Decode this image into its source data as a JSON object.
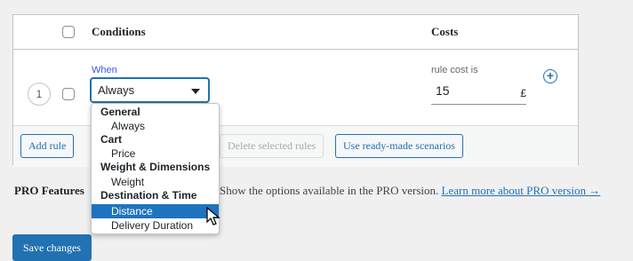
{
  "table": {
    "headers": {
      "conditions": "Conditions",
      "costs": "Costs"
    },
    "row": {
      "index": "1",
      "when_label": "When",
      "condition_value": "Always",
      "cost_label": "rule cost is",
      "cost_value": "15",
      "currency": "£"
    },
    "footer_buttons": {
      "add_rule": "Add rule",
      "delete_selected": "Delete selected rules",
      "scenarios": "Use ready-made scenarios"
    }
  },
  "dropdown": {
    "groups": [
      {
        "label": "General",
        "options": [
          "Always"
        ]
      },
      {
        "label": "Cart",
        "options": [
          "Price"
        ]
      },
      {
        "label": "Weight & Dimensions",
        "options": [
          "Weight"
        ]
      },
      {
        "label": "Destination & Time",
        "options": [
          "Distance",
          "Delivery Duration"
        ]
      }
    ],
    "highlighted": "Distance"
  },
  "pro": {
    "label": "PRO Features",
    "text": "Show the options available in the PRO version.",
    "link": "Learn more about PRO version →"
  },
  "save_label": "Save changes",
  "colors": {
    "accent": "#2271b1",
    "highlight": "#1e73be"
  }
}
